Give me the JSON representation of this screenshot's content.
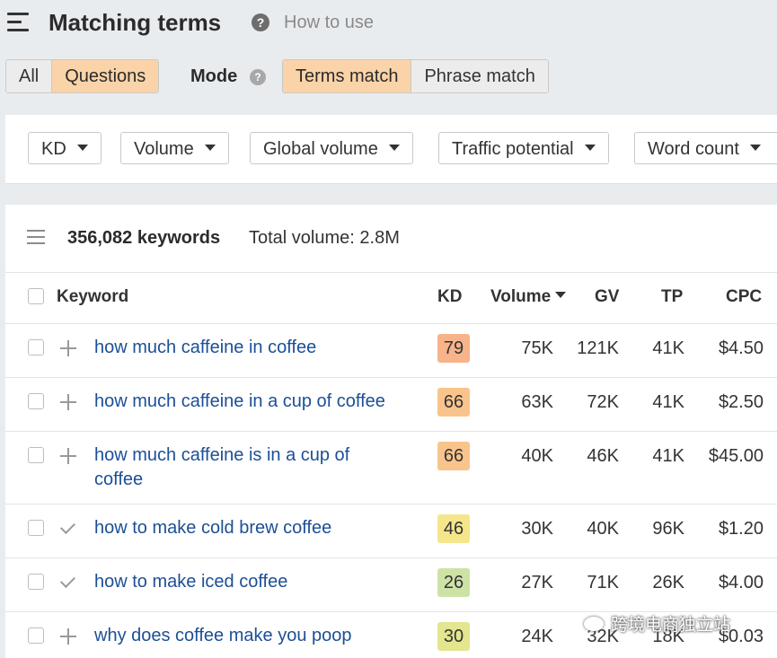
{
  "header": {
    "title": "Matching terms",
    "help": "?",
    "how_to": "How to use"
  },
  "tabs": {
    "all": "All",
    "questions": "Questions"
  },
  "mode": {
    "label": "Mode",
    "help": "?",
    "terms_match": "Terms match",
    "phrase_match": "Phrase match"
  },
  "filters": [
    "KD",
    "Volume",
    "Global volume",
    "Traffic potential",
    "Word count"
  ],
  "summary": {
    "keywords": "356,082 keywords",
    "total_volume": "Total volume: 2.8M"
  },
  "columns": {
    "keyword": "Keyword",
    "kd": "KD",
    "volume": "Volume",
    "gv": "GV",
    "tp": "TP",
    "cpc": "CPC"
  },
  "rows": [
    {
      "keyword": "how much caffeine in coffee",
      "action_icon": "plus-icon",
      "kd": "79",
      "kd_color": "#f7b38a",
      "volume": "75K",
      "gv": "121K",
      "tp": "41K",
      "cpc": "$4.50"
    },
    {
      "keyword": "how much caffeine in a cup of coffee",
      "action_icon": "plus-icon",
      "kd": "66",
      "kd_color": "#f9c48c",
      "volume": "63K",
      "gv": "72K",
      "tp": "41K",
      "cpc": "$2.50"
    },
    {
      "keyword": "how much caffeine is in a cup of coffee",
      "action_icon": "plus-icon",
      "kd": "66",
      "kd_color": "#f9c48c",
      "volume": "40K",
      "gv": "46K",
      "tp": "41K",
      "cpc": "$45.00"
    },
    {
      "keyword": "how to make cold brew coffee",
      "action_icon": "check-icon",
      "kd": "46",
      "kd_color": "#f5e68c",
      "volume": "30K",
      "gv": "40K",
      "tp": "96K",
      "cpc": "$1.20"
    },
    {
      "keyword": "how to make iced coffee",
      "action_icon": "check-icon",
      "kd": "26",
      "kd_color": "#cfe2a6",
      "volume": "27K",
      "gv": "71K",
      "tp": "26K",
      "cpc": "$4.00"
    },
    {
      "keyword": "why does coffee make you poop",
      "action_icon": "plus-icon",
      "kd": "30",
      "kd_color": "#e3e58f",
      "volume": "24K",
      "gv": "32K",
      "tp": "18K",
      "cpc": "$0.03"
    }
  ],
  "watermark": "跨境电商独立站"
}
